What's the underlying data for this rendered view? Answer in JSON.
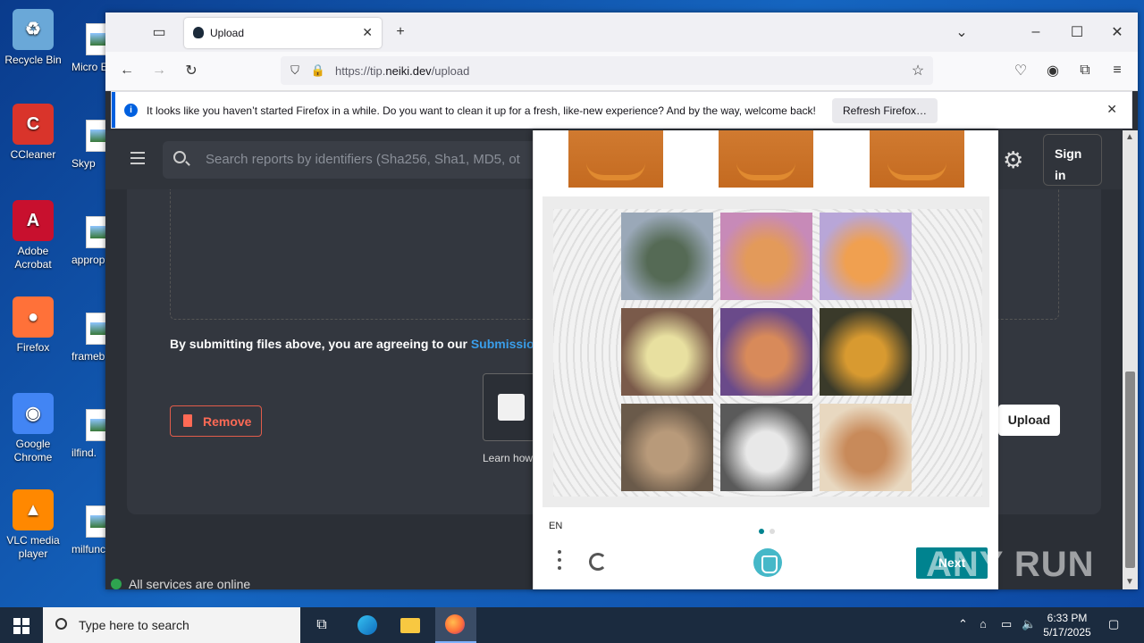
{
  "desktop": {
    "icons": [
      {
        "label": "Recycle Bin",
        "color": "#6aa8d8",
        "glyph": "♻"
      },
      {
        "label": "CCleaner",
        "color": "#d9342b",
        "glyph": "C"
      },
      {
        "label": "Adobe Acrobat",
        "color": "#c8102e",
        "glyph": "A"
      },
      {
        "label": "Firefox",
        "color": "#ff7139",
        "glyph": "●"
      },
      {
        "label": "Google Chrome",
        "color": "#4285f4",
        "glyph": "◉"
      },
      {
        "label": "VLC media player",
        "color": "#ff8800",
        "glyph": "▲"
      }
    ],
    "second_column": [
      "Micro Edg",
      "Skyp",
      "approp",
      "frameb",
      "ilfind.",
      "milfunc"
    ]
  },
  "browser": {
    "tab_title": "Upload",
    "url_prefix": "https://tip.",
    "url_domain": "neiki.dev",
    "url_path": "/upload",
    "notification": "It looks like you haven’t started Firefox in a while. Do you want to clean it up for a fresh, like-new experience? And by the way, welcome back!",
    "refresh_button": "Refresh Firefox…"
  },
  "page": {
    "search_placeholder": "Search reports by identifiers (Sha256, Sha1, MD5, ot",
    "sign_in": "Sign in",
    "agree_text": "By submitting files above, you are agreeing to our ",
    "agree_link": "Submission",
    "remove_button": "Remove",
    "learn_text": "Learn how",
    "upload_button": "Upload",
    "status_text": "All services are online"
  },
  "captcha": {
    "language": "EN",
    "next_button": "Next",
    "grid": [
      {
        "name": "bird-image-1",
        "colors": [
          "#9aa8b8",
          "#556a55"
        ]
      },
      {
        "name": "cat-image-1",
        "colors": [
          "#c78ab8",
          "#e39a5a"
        ]
      },
      {
        "name": "cat-image-2",
        "colors": [
          "#b8a6d8",
          "#f0a050"
        ]
      },
      {
        "name": "bird-image-2",
        "colors": [
          "#7a5a4a",
          "#e8e0a0"
        ]
      },
      {
        "name": "cat-image-3",
        "colors": [
          "#6a4a8a",
          "#d88a5a"
        ]
      },
      {
        "name": "bird-image-3",
        "colors": [
          "#3a3a2a",
          "#d89a30"
        ]
      },
      {
        "name": "cat-image-4",
        "colors": [
          "#6a5a4a",
          "#b89a7a"
        ]
      },
      {
        "name": "cat-image-5",
        "colors": [
          "#5a5a5a",
          "#e8e8e8"
        ]
      },
      {
        "name": "cat-image-6",
        "colors": [
          "#e8d8c0",
          "#c88a5a"
        ]
      }
    ]
  },
  "watermark": "ANY RUN",
  "taskbar": {
    "search_text": "Type here to search",
    "time": "6:33 PM",
    "date": "5/17/2025"
  }
}
